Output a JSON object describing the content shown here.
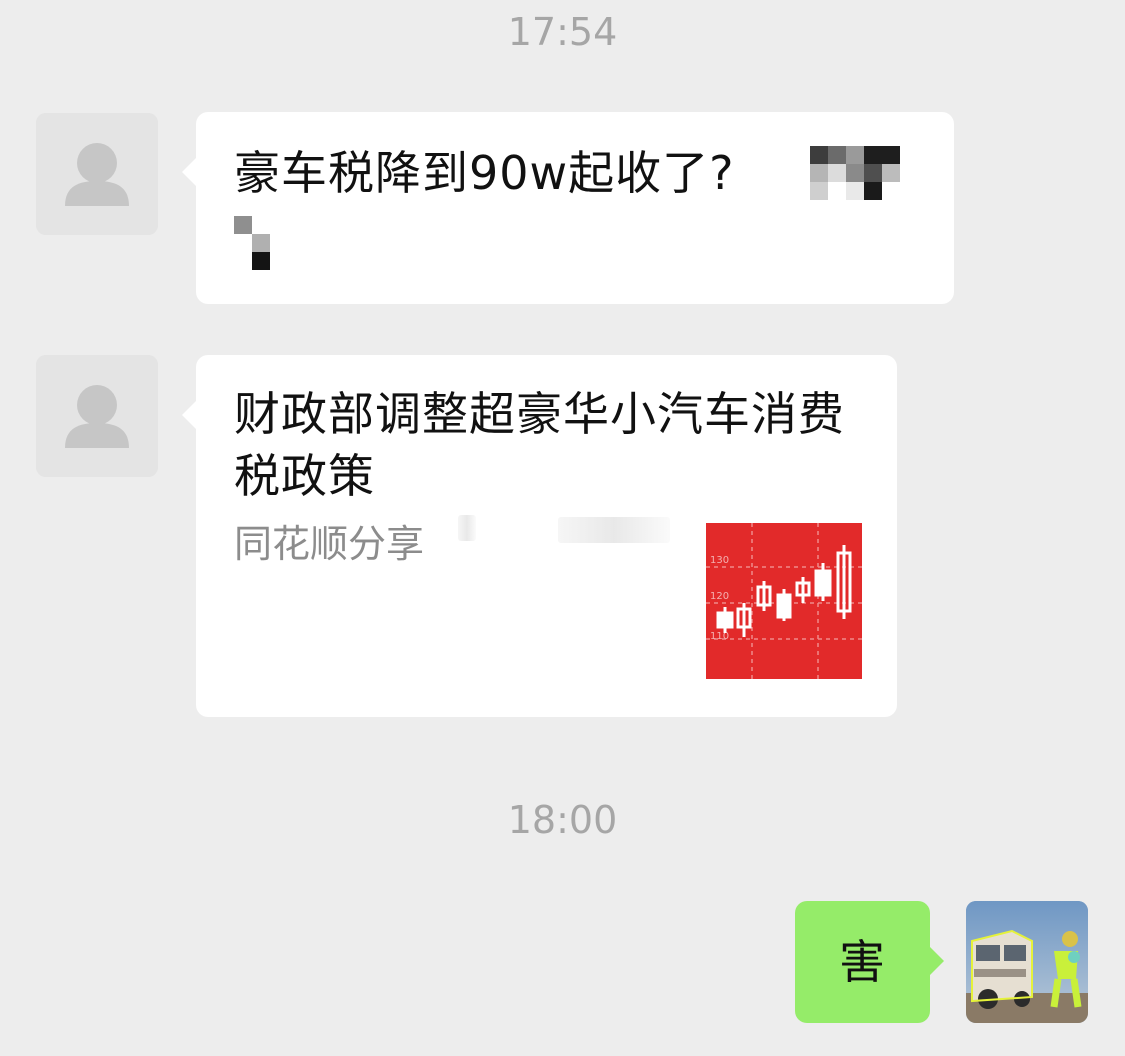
{
  "chat": {
    "timestamp_1": "17:54",
    "timestamp_2": "18:00",
    "messages": [
      {
        "sender": "contact",
        "type": "text",
        "text": "豪车税降到90w起收了?"
      },
      {
        "sender": "contact",
        "type": "link",
        "title": "财政部调整超豪华小汽车消费税政策",
        "source": "同花顺分享",
        "thumbnail": {
          "icon": "candlestick-chart-icon",
          "axis_labels": [
            "130",
            "120",
            "110"
          ],
          "background_color": "#e22a2a"
        }
      },
      {
        "sender": "me",
        "type": "text",
        "text": "害"
      }
    ]
  },
  "colors": {
    "background": "#ededed",
    "incoming_bubble": "#ffffff",
    "outgoing_bubble": "#95ec69",
    "timestamp_text": "#a6a6a6",
    "source_text": "#8c8c8c"
  }
}
